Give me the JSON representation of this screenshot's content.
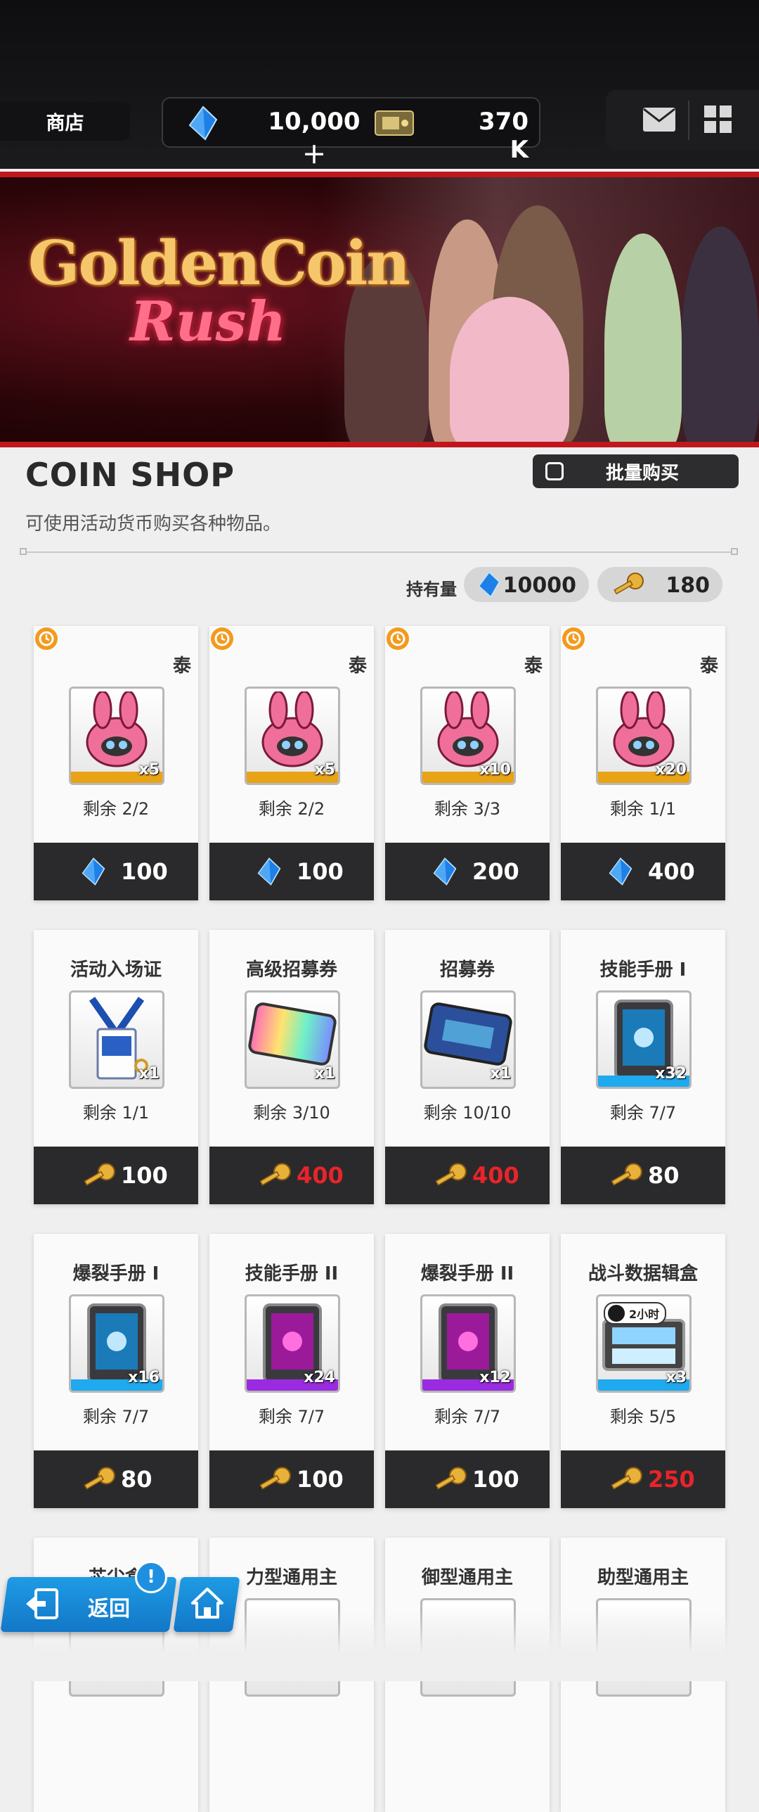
{
  "header": {
    "page_label": "商店",
    "gem_amount": "10,000＋",
    "coin_amount": "370 K"
  },
  "banner": {
    "title_line1": "GoldenCoin",
    "title_line2": "Rush"
  },
  "shop": {
    "title": "COIN SHOP",
    "description": "可使用活动货币购买各种物品。",
    "bulk_buy_label": "批量购买",
    "holdings_label": "持有量",
    "gem_holding": "10000",
    "key_holding": "180"
  },
  "items": [
    {
      "name": "泰",
      "qty": "x5",
      "remaining": "剩余 2/2",
      "price": "100",
      "currency": "gem",
      "price_red": false,
      "timed": true,
      "rarity": "#e8a316",
      "icon": "bunny-sticker-icon"
    },
    {
      "name": "泰",
      "qty": "x5",
      "remaining": "剩余 2/2",
      "price": "100",
      "currency": "gem",
      "price_red": false,
      "timed": true,
      "rarity": "#e8a316",
      "icon": "bunny-sticker-icon"
    },
    {
      "name": "泰",
      "qty": "x10",
      "remaining": "剩余 3/3",
      "price": "200",
      "currency": "gem",
      "price_red": false,
      "timed": true,
      "rarity": "#e8a316",
      "icon": "bunny-sticker-icon"
    },
    {
      "name": "泰",
      "qty": "x20",
      "remaining": "剩余 1/1",
      "price": "400",
      "currency": "gem",
      "price_red": false,
      "timed": true,
      "rarity": "#e8a316",
      "icon": "bunny-sticker-icon"
    },
    {
      "name": "活动入场证",
      "qty": "x1",
      "remaining": "剩余 1/1",
      "price": "100",
      "currency": "key",
      "price_red": false,
      "timed": false,
      "rarity": "",
      "icon": "lanyard-pass-icon"
    },
    {
      "name": "高级招募券",
      "qty": "x1",
      "remaining": "剩余 3/10",
      "price": "400",
      "currency": "key",
      "price_red": true,
      "timed": false,
      "rarity": "",
      "icon": "rainbow-ticket-icon"
    },
    {
      "name": "招募券",
      "qty": "x1",
      "remaining": "剩余 10/10",
      "price": "400",
      "currency": "key",
      "price_red": true,
      "timed": false,
      "rarity": "",
      "icon": "blue-ticket-icon"
    },
    {
      "name": "技能手册 I",
      "qty": "x32",
      "remaining": "剩余 7/7",
      "price": "80",
      "currency": "key",
      "price_red": false,
      "timed": false,
      "rarity": "#1fa9ee",
      "icon": "blue-tablet-icon"
    },
    {
      "name": "爆裂手册 I",
      "qty": "x16",
      "remaining": "剩余 7/7",
      "price": "80",
      "currency": "key",
      "price_red": false,
      "timed": false,
      "rarity": "#1fa9ee",
      "icon": "blue-tablet-icon"
    },
    {
      "name": "技能手册 II",
      "qty": "x24",
      "remaining": "剩余 7/7",
      "price": "100",
      "currency": "key",
      "price_red": false,
      "timed": false,
      "rarity": "#9a2be0",
      "icon": "purple-tablet-icon"
    },
    {
      "name": "爆裂手册 II",
      "qty": "x12",
      "remaining": "剩余 7/7",
      "price": "100",
      "currency": "key",
      "price_red": false,
      "timed": false,
      "rarity": "#9a2be0",
      "icon": "purple-tablet-icon"
    },
    {
      "name": "战斗数据辑盒",
      "qty": "x3",
      "remaining": "剩余 5/5",
      "price": "250",
      "currency": "key",
      "price_red": true,
      "timed": false,
      "rarity": "#1fa9ee",
      "icon": "data-case-icon",
      "badge": "2小时"
    },
    {
      "name": "芯尘盒",
      "qty": "",
      "remaining": "",
      "price": "",
      "currency": "",
      "price_red": false,
      "timed": false,
      "rarity": "",
      "icon": ""
    },
    {
      "name": "力型通用主",
      "qty": "",
      "remaining": "",
      "price": "",
      "currency": "",
      "price_red": false,
      "timed": false,
      "rarity": "",
      "icon": ""
    },
    {
      "name": "御型通用主",
      "qty": "",
      "remaining": "",
      "price": "",
      "currency": "",
      "price_red": false,
      "timed": false,
      "rarity": "",
      "icon": ""
    },
    {
      "name": "助型通用主",
      "qty": "",
      "remaining": "",
      "price": "",
      "currency": "",
      "price_red": false,
      "timed": false,
      "rarity": "",
      "icon": ""
    }
  ],
  "nav": {
    "back_label": "返回",
    "alert_mark": "!"
  },
  "colors": {
    "accent_blue": "#1f8fe0",
    "banner_red": "#c0171d",
    "price_red": "#e8242a"
  }
}
